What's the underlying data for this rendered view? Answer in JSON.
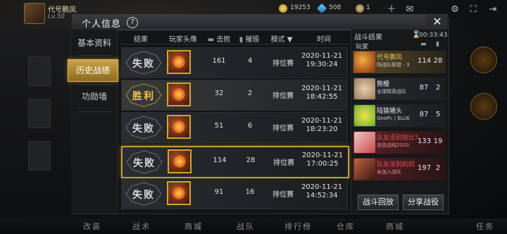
{
  "hud": {
    "username": "代号鹏凤",
    "level": "Lv.30",
    "gold": "19253",
    "diamond": "508",
    "ticket": "1"
  },
  "panel": {
    "title": "个人信息",
    "help": "?",
    "close": "✕"
  },
  "tabs": [
    {
      "label": "基本资料"
    },
    {
      "label": "历史战绩"
    },
    {
      "label": "功勋墙"
    }
  ],
  "columns": {
    "result": "结果",
    "avatar": "玩家头像",
    "kills": "击败",
    "destroy": "摧毁",
    "mode": "模式 ▼",
    "time": "时间"
  },
  "rows": [
    {
      "result": "失败",
      "kills": "161",
      "destroy": "4",
      "mode": "排位赛",
      "date": "2020-11-21",
      "clock": "19:30:24",
      "win": false
    },
    {
      "result": "胜利",
      "kills": "32",
      "destroy": "2",
      "mode": "排位赛",
      "date": "2020-11-21",
      "clock": "18:42:55",
      "win": true
    },
    {
      "result": "失败",
      "kills": "51",
      "destroy": "6",
      "mode": "排位赛",
      "date": "2020-11-21",
      "clock": "18:23:20",
      "win": false
    },
    {
      "result": "失败",
      "kills": "114",
      "destroy": "28",
      "mode": "排位赛",
      "date": "2020-11-21",
      "clock": "17:00:25",
      "win": false
    },
    {
      "result": "失败",
      "kills": "91",
      "destroy": "16",
      "mode": "排位赛",
      "date": "2020-11-21",
      "clock": "14:52:34",
      "win": false
    }
  ],
  "battle": {
    "title": "战斗结果",
    "duration": "00:33:43",
    "player_col": "玩家",
    "players": [
      {
        "name": "代号鹏凤",
        "team": "陆战队联盟 - 3",
        "kills": "114",
        "deaths": "28",
        "color": "#e8c860"
      },
      {
        "name": "熊樱",
        "team": "全球精英战队",
        "kills": "87",
        "deaths": "2",
        "color": "#e8e8e8"
      },
      {
        "name": "陆猿猪头",
        "team": "OnePc丨BLUE",
        "kills": "87",
        "deaths": "5",
        "color": "#e8e8e8"
      },
      {
        "name": "队友没别挂比?",
        "team": "自由战线2020",
        "kills": "133",
        "deaths": "19",
        "color": "#e85050"
      },
      {
        "name": "队友没别的的",
        "team": "未加入战队",
        "kills": "197",
        "deaths": "2",
        "color": "#e85050"
      }
    ],
    "replay": "战斗回放",
    "share": "分享战役"
  },
  "bottom_nav": [
    "改装",
    "战术",
    "商城",
    "战队",
    "排行榜",
    "仓库",
    "商城",
    "任务"
  ]
}
